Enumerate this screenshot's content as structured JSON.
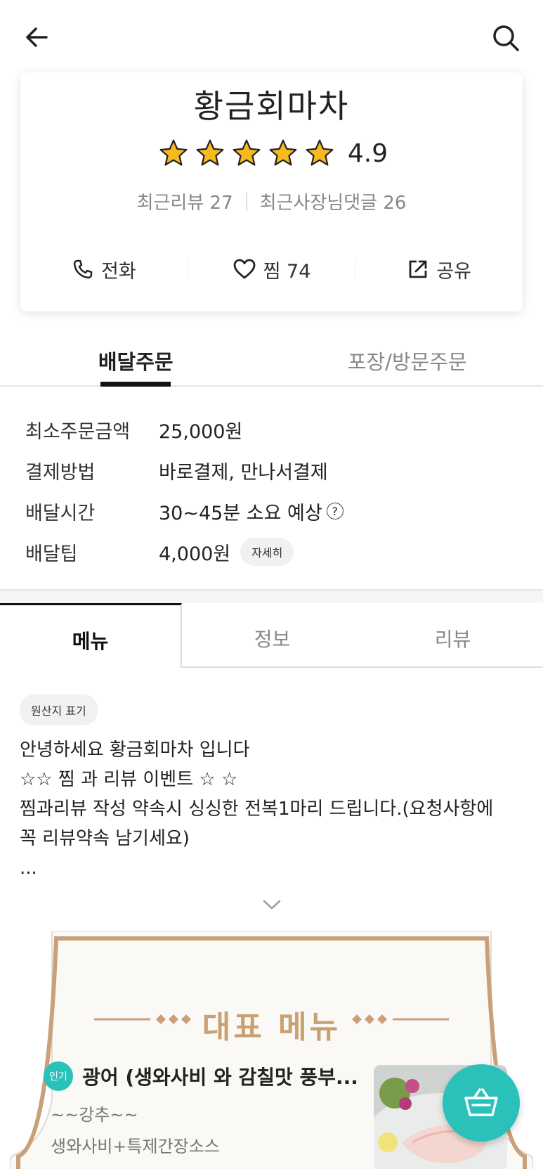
{
  "header": {
    "back_icon": "arrow-left-icon",
    "search_icon": "search-icon"
  },
  "store": {
    "name": "황금회마차",
    "rating": "4.9",
    "stars": 5,
    "recent_reviews_label": "최근리뷰 27",
    "owner_replies_label": "최근사장님댓글 26",
    "actions": {
      "call": "전화",
      "like": "찜 74",
      "share": "공유"
    }
  },
  "order_tabs": {
    "delivery": "배달주문",
    "pickup": "포장/방문주문"
  },
  "order_info": {
    "min_order_label": "최소주문금액",
    "min_order_value": "25,000원",
    "payment_label": "결제방법",
    "payment_value": "바로결제, 만나서결제",
    "delivery_time_label": "배달시간",
    "delivery_time_value": "30~45분 소요 예상",
    "help_symbol": "?",
    "delivery_tip_label": "배달팁",
    "delivery_tip_value": "4,000원",
    "detail_button": "자세히"
  },
  "menu_tabs": {
    "menu": "메뉴",
    "info": "정보",
    "review": "리뷰"
  },
  "origin_chip": "원산지 표기",
  "notice": {
    "line1": "안녕하세요 황금회마차 입니다",
    "line2": "☆☆ 찜 과 리뷰 이벤트 ☆ ☆",
    "line3": "찜과리뷰 작성 약속시  싱싱한 전복1마리 드립니다.(요청사항에",
    "line4": "꼭 리뷰약속  남기세요)",
    "line5": "..."
  },
  "featured": {
    "title": "대표 메뉴",
    "item": {
      "badge": "인기",
      "name": "광어 (생와사비 와 감칠맛 풍부...",
      "desc1": "~~강추~~",
      "desc2": "생와사비+특제간장소스"
    }
  },
  "colors": {
    "accent": "#2bc1bb",
    "gold": "#c9a070",
    "star": "#f6b91f"
  }
}
